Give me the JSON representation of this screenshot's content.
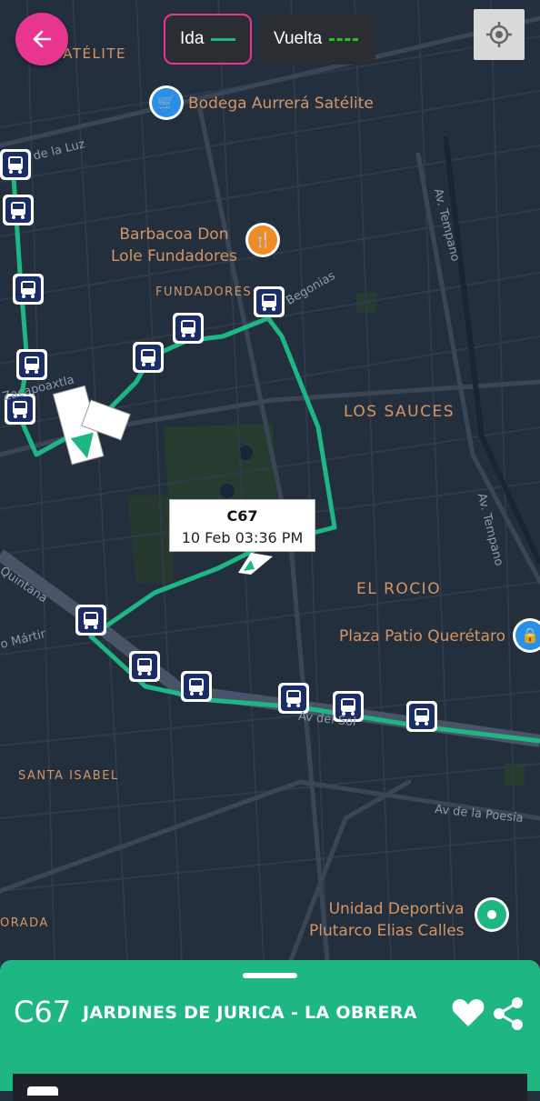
{
  "header": {
    "back_icon": "arrow-left-icon",
    "legend": [
      {
        "label": "Ida",
        "style": "solid",
        "color": "#1eb784",
        "active": true
      },
      {
        "label": "Vuelta",
        "style": "dashed",
        "color": "#22c322",
        "active": false
      }
    ],
    "locate_icon": "crosshair-icon"
  },
  "map": {
    "neighborhoods": [
      "SATÉLITE",
      "FUNDADORES",
      "LOS SAUCES",
      "EL ROCIO",
      "SANTA ISABEL",
      "ORADA"
    ],
    "streets": [
      "de la Luz",
      "Av. Tempano",
      "Begonias",
      "Zacapoaxtla",
      "Av. Tempano",
      "Quintana",
      "o Mártir",
      "Av del Sol",
      "Av de la Poesía"
    ],
    "pois": [
      {
        "name": "Bodega Aurrerá Satélite",
        "icon": "shopping-cart-icon",
        "color": "#2a8fe8"
      },
      {
        "name": "Barbacoa Don Lole Fundadores",
        "line1": "Barbacoa Don",
        "line2": "Lole Fundadores",
        "icon": "fork-knife-icon",
        "color": "#f08c28"
      },
      {
        "name": "Plaza Patio Querétaro",
        "icon": "shopping-bag-icon",
        "color": "#2a8fe8"
      },
      {
        "name": "Unidad Deportiva Plutarco Elias Calles",
        "line1": "Unidad Deportiva",
        "line2": "Plutarco Elias Calles",
        "icon": "park-icon",
        "color": "#1eb784"
      }
    ],
    "route_color": "#1eb784",
    "stop_icon": "bus-icon",
    "vehicle_icon": "bus-vehicle-icon",
    "tooltip": {
      "route": "C67",
      "timestamp": "10 Feb 03:36 PM"
    }
  },
  "sheet": {
    "route_code": "C67",
    "route_name": "JARDINES DE JURICA - LA OBRERA",
    "favorite_icon": "heart-icon",
    "share_icon": "share-icon",
    "color": "#1eb784"
  }
}
